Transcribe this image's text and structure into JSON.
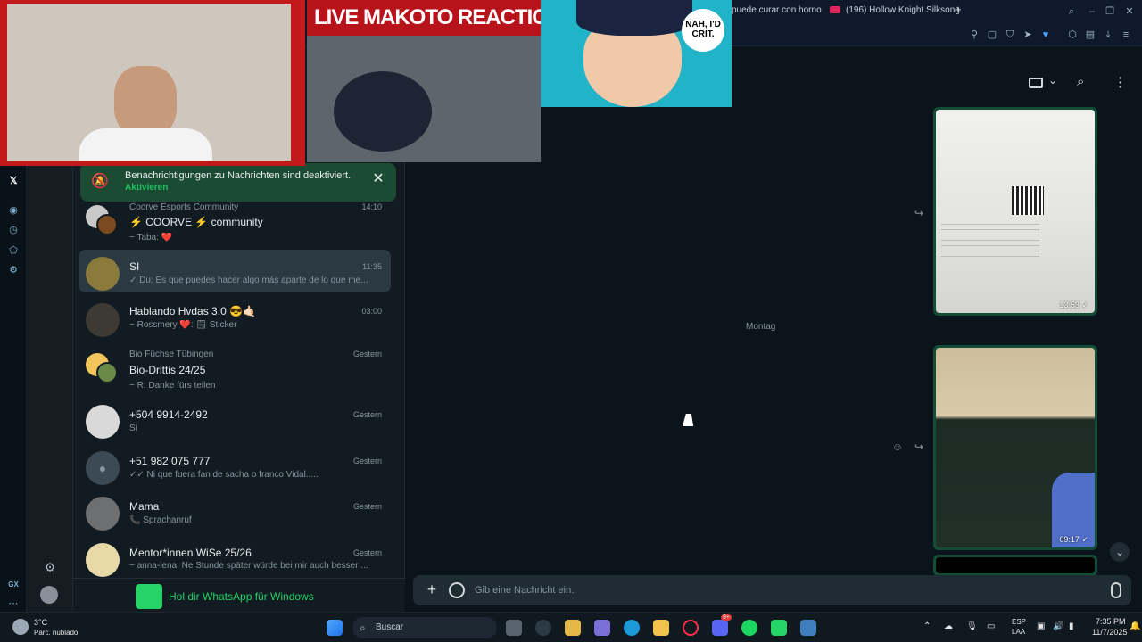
{
  "browser": {
    "tabs": [
      {
        "label": "puede curar con horno"
      },
      {
        "label": "(196) Hollow Knight Silksong"
      }
    ],
    "new_tab": "+"
  },
  "stream": {
    "title": "LIVE MAKOTO REACTION",
    "speech_bubble": "NAH, I'D CRIT."
  },
  "notification": {
    "text": "Benachrichtigungen zu Nachrichten sind deaktiviert.",
    "action": "Aktivieren"
  },
  "chats": [
    {
      "group": "Coorve Esports Community",
      "name": "⚡ COORVE ⚡ community",
      "message": "~ Taba: ❤️",
      "time": "14:10"
    },
    {
      "name": "SI",
      "message": "✓ Du: Es que puedes hacer algo más aparte de lo que me...",
      "time": "11:35",
      "selected": true
    },
    {
      "name": "Hablando Hvdas 3.0 😎🤙🏻",
      "message": "~ Rossmery ❤️: 🗒 Sticker",
      "time": "03:00"
    },
    {
      "group": "Bio Füchse Tübingen",
      "name": "Bio-Drittis 24/25",
      "message": "~ R: Danke fürs teilen",
      "time": "Gestern"
    },
    {
      "name": "+504 9914-2492",
      "message": "Si",
      "time": "Gestern"
    },
    {
      "name": "+51 982 075 777",
      "message": "✓✓ Ni que fuera fan de sacha o franco Vidal.....",
      "time": "Gestern"
    },
    {
      "name": "Mama",
      "message": "📞 Sprachanruf",
      "time": "Gestern"
    },
    {
      "name": "Mentor*innen WiSe 25/26",
      "message": "~ anna-lena: Ne Stunde später würde bei mir auch besser ...",
      "time": "Gestern"
    }
  ],
  "promo": {
    "text": "Hol dir WhatsApp für Windows"
  },
  "conversation": {
    "day_label": "Montag",
    "images": [
      {
        "time": "13:53",
        "status": "✓"
      },
      {
        "time": "09:17",
        "status": "✓"
      }
    ],
    "composer_placeholder": "Gib eine Nachricht ein."
  },
  "gx": {
    "label": "GX"
  },
  "taskbar": {
    "weather_temp": "3°C",
    "weather_desc": "Parc. nublado",
    "search_label": "Buscar",
    "lang_top": "ESP",
    "lang_bottom": "LAA",
    "time": "7:35 PM",
    "date": "11/7/2025",
    "discord_badge": "9+"
  },
  "colors": {
    "whatsapp_green": "#25d366",
    "bubble_out": "#144d37",
    "panel": "#111b21",
    "stream_red": "#c21a1a"
  }
}
